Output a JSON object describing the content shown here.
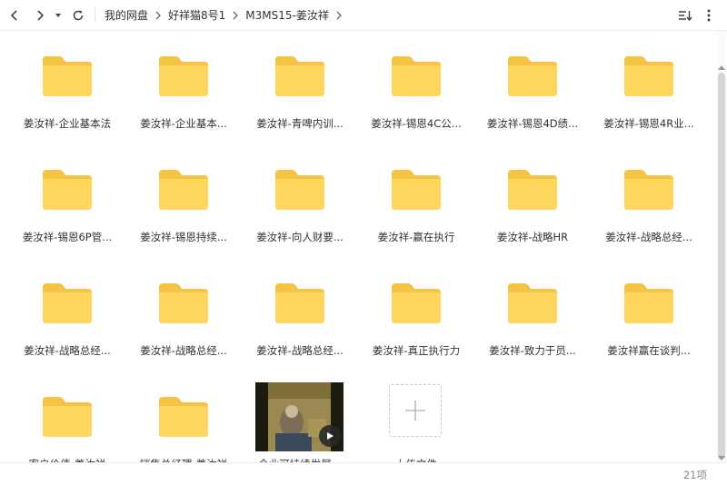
{
  "nav": {
    "back_icon": "chevron-left-icon",
    "forward_icon": "chevron-right-icon",
    "history_icon": "caret-down-icon",
    "refresh_icon": "refresh-icon"
  },
  "breadcrumb": [
    "我的网盘",
    "好祥猫8号1",
    "M3MS15-姜汝祥"
  ],
  "toolbar": {
    "sort_icon": "sort-icon",
    "more_icon": "more-vertical-icon"
  },
  "colors": {
    "folder_back": "#f5c443",
    "folder_front": "#ffd75e",
    "accent": "#1677ff"
  },
  "files": [
    {
      "name": "姜汝祥-企业基本法",
      "type": "folder"
    },
    {
      "name": "姜汝祥-企业基本...",
      "type": "folder"
    },
    {
      "name": "姜汝祥-青啤内训...",
      "type": "folder"
    },
    {
      "name": "姜汝祥-锡恩4C公...",
      "type": "folder"
    },
    {
      "name": "姜汝祥-锡恩4D绩...",
      "type": "folder"
    },
    {
      "name": "姜汝祥-锡恩4R业...",
      "type": "folder"
    },
    {
      "name": "姜汝祥-锡恩6P管...",
      "type": "folder"
    },
    {
      "name": "姜汝祥-锡恩持续...",
      "type": "folder"
    },
    {
      "name": "姜汝祥-向人财要...",
      "type": "folder"
    },
    {
      "name": "姜汝祥-赢在执行",
      "type": "folder"
    },
    {
      "name": "姜汝祥-战略HR",
      "type": "folder"
    },
    {
      "name": "姜汝祥-战略总经...",
      "type": "folder"
    },
    {
      "name": "姜汝祥-战略总经...",
      "type": "folder"
    },
    {
      "name": "姜汝祥-战略总经...",
      "type": "folder"
    },
    {
      "name": "姜汝祥-战略总经...",
      "type": "folder"
    },
    {
      "name": "姜汝祥-真正执行力",
      "type": "folder"
    },
    {
      "name": "姜汝祥-致力于员...",
      "type": "folder"
    },
    {
      "name": "姜汝祥赢在谈判...",
      "type": "folder"
    },
    {
      "name": "客户价值-姜汝祥",
      "type": "folder"
    },
    {
      "name": "销售总经理-姜汝祥",
      "type": "folder"
    },
    {
      "name": "企业可持续发展...",
      "type": "video"
    },
    {
      "name": "上传文件",
      "type": "upload"
    }
  ],
  "footer": {
    "count": "21项"
  }
}
